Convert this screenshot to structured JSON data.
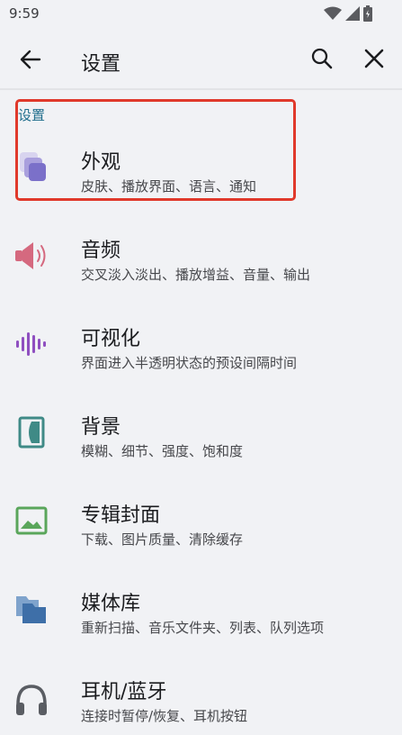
{
  "status": {
    "time": "9:59"
  },
  "app_bar": {
    "title": "设置"
  },
  "section": {
    "header": "设置"
  },
  "items": [
    {
      "title": "外观",
      "subtitle": "皮肤、播放界面、语言、通知"
    },
    {
      "title": "音频",
      "subtitle": "交叉淡入淡出、播放增益、音量、输出"
    },
    {
      "title": "可视化",
      "subtitle": "界面进入半透明状态的预设间隔时间"
    },
    {
      "title": "背景",
      "subtitle": "模糊、细节、强度、饱和度"
    },
    {
      "title": "专辑封面",
      "subtitle": "下载、图片质量、清除缓存"
    },
    {
      "title": "媒体库",
      "subtitle": "重新扫描、音乐文件夹、列表、队列选项"
    },
    {
      "title": "耳机/蓝牙",
      "subtitle": "连接时暂停/恢复、耳机按钮"
    }
  ],
  "colors": {
    "background": "#f1f2f5",
    "accent_text": "#1f6d8c",
    "highlight_border": "#e0392b",
    "icon_appearance": "#7b70c9",
    "icon_audio": "#d5697f",
    "icon_visual": "#8f4fc0",
    "icon_background": "#3f8a86",
    "icon_album": "#5aa65b",
    "icon_library": "#3e6fa8",
    "icon_headset": "#5a5d63"
  }
}
